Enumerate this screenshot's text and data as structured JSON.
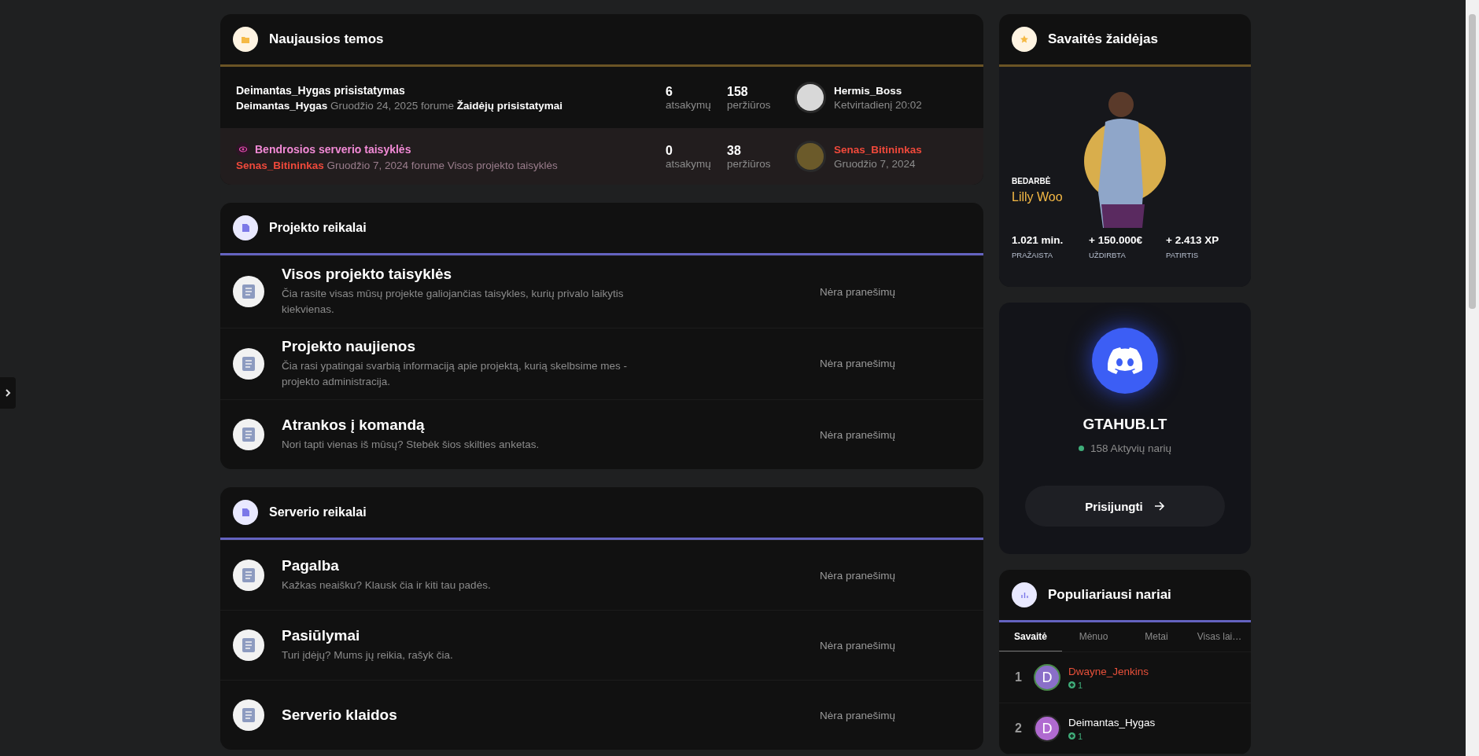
{
  "latest": {
    "title": "Naujausios temos",
    "topics": [
      {
        "kind": "normal",
        "title": "Deimantas_Hygas prisistatymas",
        "author": {
          "name": "Deimantas_Hygas",
          "color": "#ffffff"
        },
        "date": "Gruodžio 24, 2025",
        "forum_prefix": "forume",
        "forum": "Žaidėjų prisistatymai",
        "replies": "6",
        "replies_label": "atsakymų",
        "views": "158",
        "views_label": "peržiūros",
        "last": {
          "name": "Hermis_Boss",
          "color": "#ffffff",
          "time": "Ketvirtadienį 20:02"
        }
      },
      {
        "kind": "pinned",
        "title": "Bendrosios serverio taisyklės",
        "author": {
          "name": "Senas_Bitininkas",
          "color": "#f0493b"
        },
        "date": "Gruodžio 7, 2024",
        "forum_prefix": "forume",
        "forum": "Visos projekto taisyklės",
        "replies": "0",
        "replies_label": "atsakymų",
        "views": "38",
        "views_label": "peržiūros",
        "last": {
          "name": "Senas_Bitininkas",
          "color": "#f0493b",
          "time": "Gruodžio 7, 2024"
        }
      }
    ]
  },
  "categories": [
    {
      "title": "Projekto reikalai",
      "forums": [
        {
          "name": "Visos projekto taisyklės",
          "description": "Čia rasite visas mūsų projekte galiojančias taisykles, kurių privalo laikytis kiekvienas.",
          "status": "Nėra pranešimų"
        },
        {
          "name": "Projekto naujienos",
          "description": "Čia rasi ypatingai svarbią informaciją apie projektą, kurią skelbsime mes - projekto administracija.",
          "status": "Nėra pranešimų"
        },
        {
          "name": "Atrankos į komandą",
          "description": "Nori tapti vienas iš mūsų? Stebėk šios skilties anketas.",
          "status": "Nėra pranešimų"
        }
      ]
    },
    {
      "title": "Serverio reikalai",
      "forums": [
        {
          "name": "Pagalba",
          "description": "Kažkas neaišku? Klausk čia ir kiti tau padės.",
          "status": "Nėra pranešimų"
        },
        {
          "name": "Pasiūlymai",
          "description": "Turi įdėjų? Mums jų reikia, rašyk čia.",
          "status": "Nėra pranešimų"
        },
        {
          "name": "Serverio klaidos",
          "status": "Nėra pranešimų"
        }
      ]
    }
  ],
  "player_of_week": {
    "title": "Savaitės žaidėjas",
    "job": "BEDARBĖ",
    "name": "Lilly Woo",
    "stats": [
      {
        "value": "1.021 min.",
        "label": "PRAŽAISTA"
      },
      {
        "value": "+ 150.000€",
        "label": "UŽDIRBTA"
      },
      {
        "value": "+ 2.413 XP",
        "label": "PATIRTIS"
      }
    ]
  },
  "discord": {
    "name": "GTAHUB.LT",
    "online": "158 Aktyvių narių",
    "button": "Prisijungti"
  },
  "popular": {
    "title": "Populiariausi nariai",
    "tabs": [
      {
        "label": "Savaitė",
        "selected": true
      },
      {
        "label": "Mėnuo",
        "selected": false
      },
      {
        "label": "Metai",
        "selected": false
      },
      {
        "label": "Visas lai…",
        "selected": false
      }
    ],
    "members": [
      {
        "rank": "1",
        "initial": "D",
        "name": "Dwayne_Jenkins",
        "color": "#e8503a",
        "points": "1"
      },
      {
        "rank": "2",
        "initial": "D",
        "name": "Deimantas_Hygas",
        "color": "#ffffff",
        "points": "1"
      }
    ]
  }
}
